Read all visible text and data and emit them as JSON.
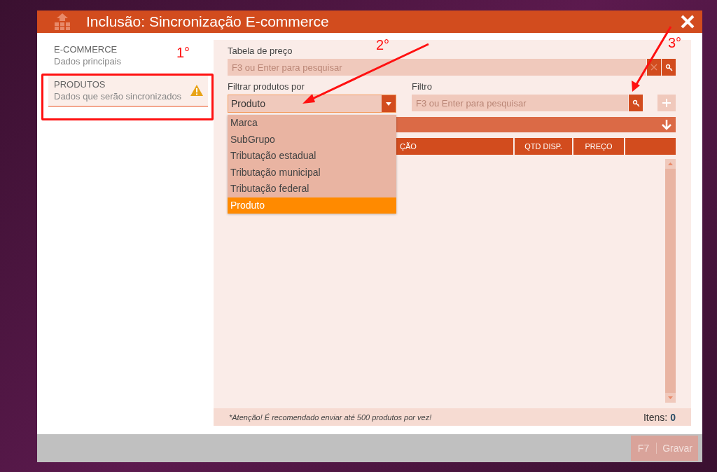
{
  "window": {
    "title": "Inclusão: Sincronização E-commerce"
  },
  "sidebar": {
    "items": [
      {
        "title": "E-COMMERCE",
        "subtitle": "Dados principais",
        "selected": false,
        "warning": false
      },
      {
        "title": "PRODUTOS",
        "subtitle": "Dados que serão sincronizados",
        "selected": true,
        "warning": true
      }
    ]
  },
  "price_table": {
    "label": "Tabela de preço",
    "placeholder": "F3 ou Enter para pesquisar"
  },
  "filter_by": {
    "label": "Filtrar produtos por",
    "value": "Produto",
    "expanded": true,
    "options": [
      {
        "label": "Marca",
        "selected": false
      },
      {
        "label": "SubGrupo",
        "selected": false
      },
      {
        "label": "Tributação estadual",
        "selected": false
      },
      {
        "label": "Tributação municipal",
        "selected": false
      },
      {
        "label": "Tributação federal",
        "selected": false
      },
      {
        "label": "Produto",
        "selected": true
      }
    ]
  },
  "filter": {
    "label": "Filtro",
    "placeholder": "F3 ou Enter para pesquisar"
  },
  "table": {
    "columns": [
      "ÇÃO",
      "QTD DISP.",
      "PREÇO"
    ]
  },
  "footer": {
    "note": "*Atenção! É recomendado enviar até 500 produtos por vez!",
    "count_label": "Itens:",
    "count": "0"
  },
  "actions": [
    {
      "key": "F7",
      "label": "Gravar",
      "disabled": true
    }
  ],
  "annotations": [
    {
      "label": "1°"
    },
    {
      "label": "2°"
    },
    {
      "label": "3°"
    }
  ]
}
